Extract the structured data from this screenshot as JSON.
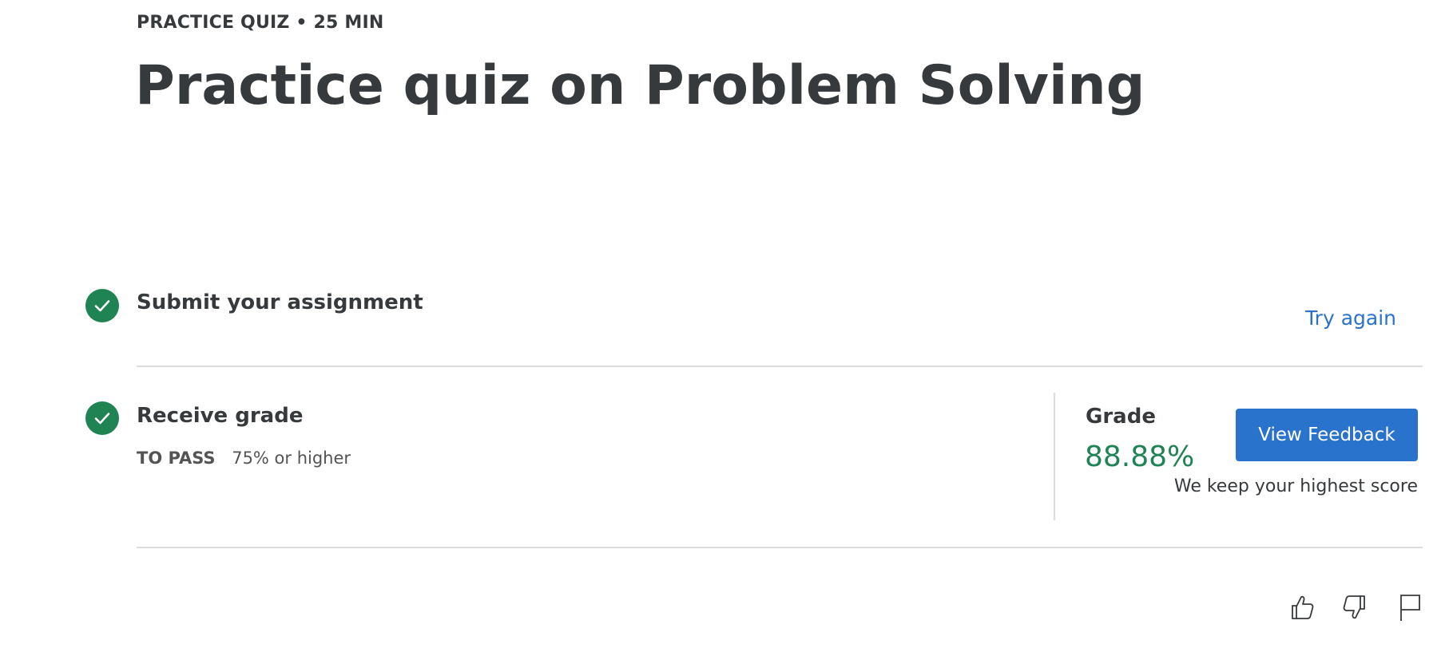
{
  "header": {
    "eyebrow": "PRACTICE QUIZ • 25 MIN",
    "title": "Practice quiz on Problem Solving"
  },
  "steps": [
    {
      "icon": "check-circle-icon",
      "heading": "Submit your assignment",
      "action_label": "Try again"
    },
    {
      "icon": "check-circle-icon",
      "heading": "Receive grade",
      "pass_label": "TO PASS",
      "pass_value": "75% or higher",
      "grade_label": "Grade",
      "grade_value": "88.88%",
      "button_label": "View Feedback",
      "note": "We keep your highest score"
    }
  ],
  "feedback_icons": [
    "thumbs-up-icon",
    "thumbs-down-icon",
    "flag-icon"
  ],
  "colors": {
    "success": "#1f8354",
    "link": "#2a73cc",
    "button": "#2a73cc",
    "text": "#373a3c",
    "divider": "#dcdcdc"
  }
}
